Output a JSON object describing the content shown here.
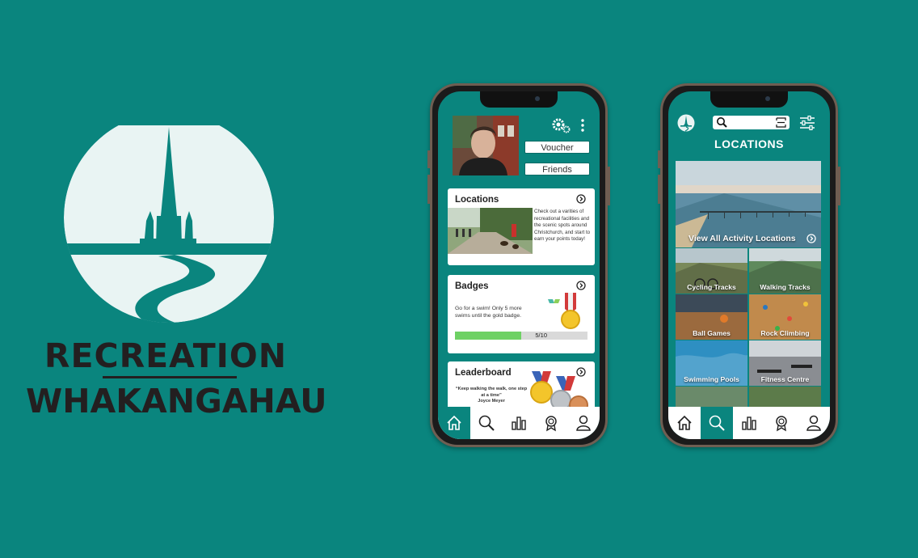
{
  "brand": {
    "line1": "RECREATION",
    "line2": "WHAKANGAHAU",
    "colors": {
      "background": "#0a857e",
      "text": "#231f20",
      "logo": "#e9f4f3"
    }
  },
  "home_screen": {
    "icons": [
      "settings-icon",
      "more-icon"
    ],
    "voucher_label": "Voucher",
    "friends_label": "Friends",
    "locations_card": {
      "title": "Locations",
      "description": "Check out a varities of recreational facilities and the scenic spots around Christchurch, and start to earn your points today!"
    },
    "badges_card": {
      "title": "Badges",
      "description": "Go for a swim! Only 5 more swims until the gold badge.",
      "progress_label": "5/10",
      "progress": 0.5
    },
    "leaderboard_card": {
      "title": "Leaderboard",
      "quote": "“Keep walking the walk, one step at a time”",
      "author": "Joyce Meyer"
    },
    "nav": [
      "home-icon",
      "search-icon",
      "stats-icon",
      "badge-icon",
      "profile-icon"
    ],
    "active_nav": "home"
  },
  "locations_screen": {
    "title": "LOCATIONS",
    "hero_label": "View All Activity Locations",
    "tiles": [
      {
        "label": "Cycling Tracks",
        "color": "#7a8a5a"
      },
      {
        "label": "Walking Tracks",
        "color": "#5f8a5c"
      },
      {
        "label": "Ball Games",
        "color": "#9b6a3e"
      },
      {
        "label": "Rock Climbing",
        "color": "#c18a4c"
      },
      {
        "label": "Swimming Pools",
        "color": "#2e8fc2"
      },
      {
        "label": "Fitness Centre",
        "color": "#8a8d92"
      }
    ],
    "nav": [
      "home-icon",
      "search-icon",
      "stats-icon",
      "badge-icon",
      "profile-icon"
    ],
    "active_nav": "search"
  }
}
